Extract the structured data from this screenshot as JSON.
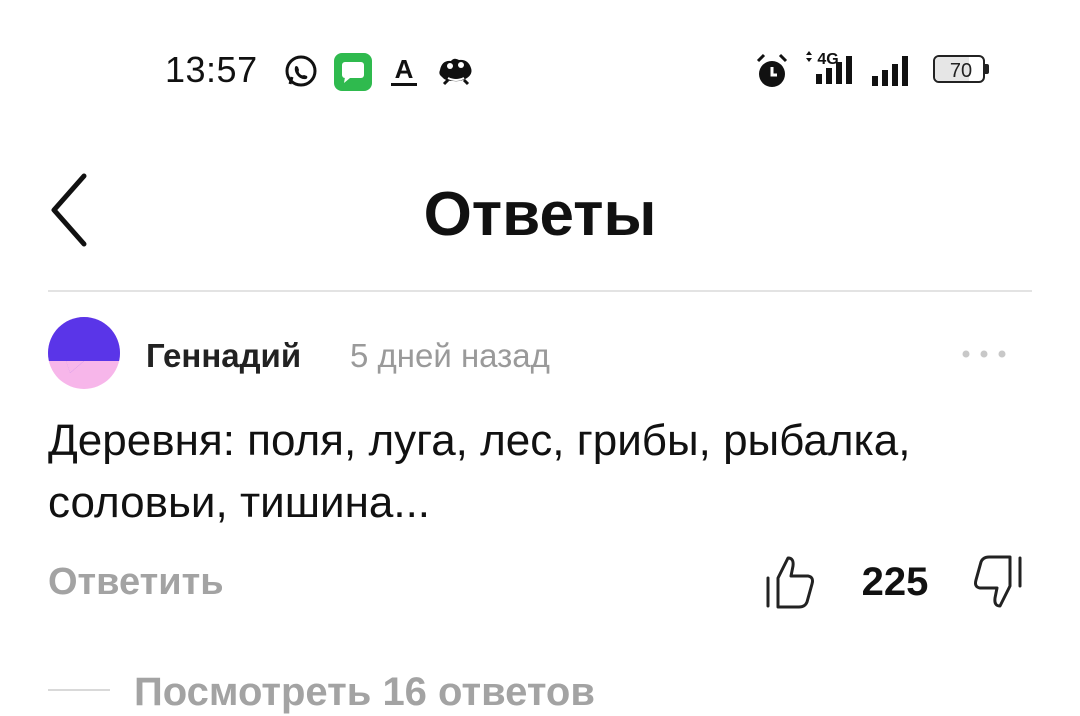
{
  "status_bar": {
    "time": "13:57",
    "network_label": "4G",
    "battery_level": "70",
    "icons": [
      "whatsapp-icon",
      "messages-icon",
      "translate-icon",
      "frog-icon",
      "alarm-icon",
      "signal-4g-icon",
      "signal-icon",
      "battery-icon"
    ]
  },
  "header": {
    "title": "Ответы",
    "back_icon": "chevron-left-icon"
  },
  "comment": {
    "author": "Геннадий",
    "time_ago": "5 дней назад",
    "text": "Деревня: поля, луга, лес, грибы, рыбалка, соловьи, тишина...",
    "reply_label": "Ответить",
    "likes": "225",
    "icons": [
      "avatar",
      "more-icon",
      "thumbs-up-icon",
      "thumbs-down-icon"
    ]
  },
  "replies": {
    "view_label": "Посмотреть 16 ответов"
  },
  "colors": {
    "text_primary": "#111111",
    "text_secondary": "#9a9a9a",
    "divider": "#e3e3e3",
    "avatar_blue": "#5a35e8",
    "avatar_pink": "#f7b6ea"
  }
}
